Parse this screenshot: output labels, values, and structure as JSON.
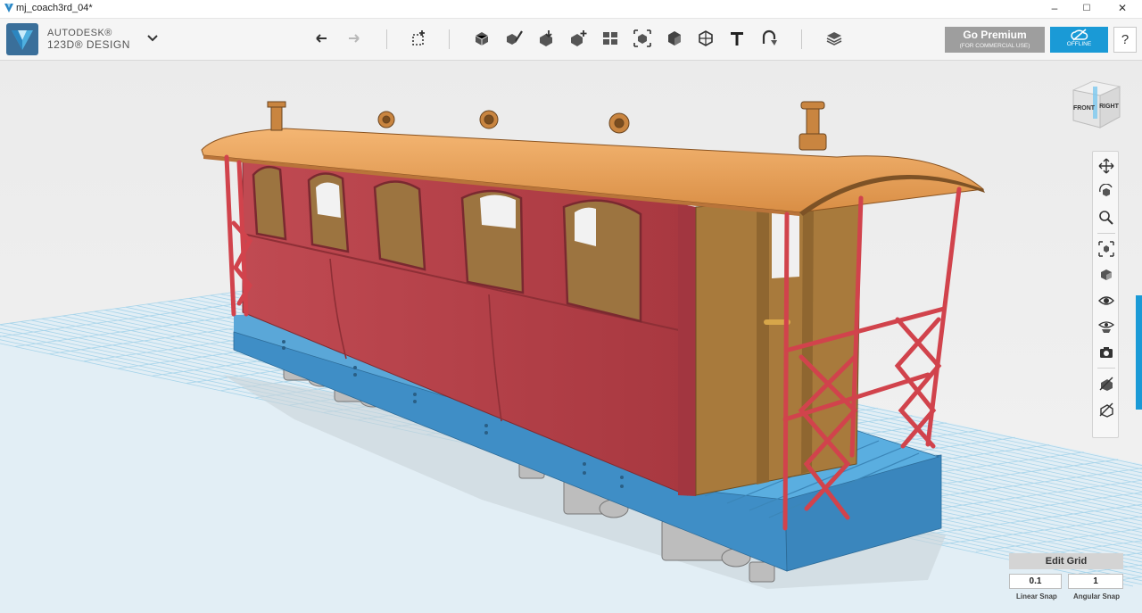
{
  "window": {
    "title": "mj_coach3rd_04*",
    "minimize": "–",
    "maximize": "☐",
    "close": "✕"
  },
  "brand": {
    "line1": "AUTODESK®",
    "line2": "123D® DESIGN"
  },
  "toolbar": {
    "tools": [
      "undo-icon",
      "redo-icon",
      "primitives-icon",
      "sketch-icon",
      "construct-icon",
      "modify-icon",
      "pattern-icon",
      "grouping-icon",
      "snap-icon",
      "combine-icon",
      "measure-icon",
      "text-icon",
      "material-icon",
      "layers-icon"
    ]
  },
  "premium": {
    "label": "Go Premium",
    "sub": "(FOR COMMERCIAL USE)"
  },
  "offline": {
    "label": "OFFLINE"
  },
  "help": {
    "label": "?"
  },
  "viewcube": {
    "front": "FRONT",
    "right": "RIGHT"
  },
  "nav": {
    "items": [
      "pan-icon",
      "orbit-icon",
      "zoom-icon",
      "fit-icon",
      "view-icon",
      "visibility-icon",
      "material-display-icon",
      "snapshot-icon",
      "solid-view-icon",
      "outline-view-icon"
    ]
  },
  "grid": {
    "title": "Edit Grid",
    "linear_value": "0.1",
    "linear_label": "Linear Snap",
    "angular_value": "1",
    "angular_label": "Angular Snap"
  },
  "colors": {
    "accent": "#1a9ad6",
    "premium": "#9e9e9e",
    "body_red": "#b24048",
    "roof": "#e9a05c",
    "chassis": "#3f8ec6",
    "interior": "#a87a3c",
    "grid_line": "#9fd1ea"
  }
}
